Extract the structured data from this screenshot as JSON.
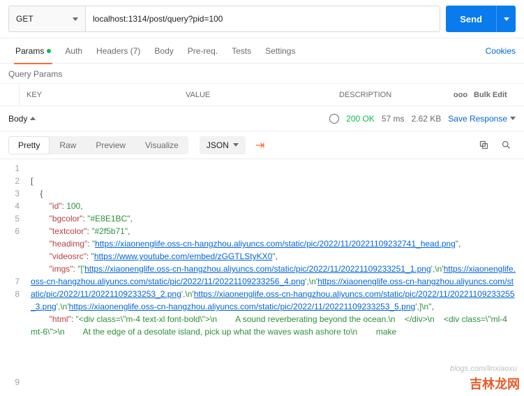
{
  "request": {
    "method": "GET",
    "url": "localhost:1314/post/query?pid=100",
    "send_label": "Send"
  },
  "tabs": {
    "params": "Params",
    "auth": "Auth",
    "headers": "Headers (7)",
    "body": "Body",
    "prereq": "Pre-req.",
    "tests": "Tests",
    "settings": "Settings",
    "cookies": "Cookies"
  },
  "query_params_label": "Query Params",
  "kv": {
    "key": "KEY",
    "value": "VALUE",
    "desc": "DESCRIPTION",
    "more": "ooo",
    "bulk": "Bulk Edit"
  },
  "response": {
    "body_label": "Body",
    "status": "200 OK",
    "time": "57 ms",
    "size": "2.62 KB",
    "save": "Save Response"
  },
  "view": {
    "pretty": "Pretty",
    "raw": "Raw",
    "preview": "Preview",
    "visualize": "Visualize",
    "format": "JSON"
  },
  "json": {
    "id_key": "\"id\"",
    "id_val": "100",
    "bg_key": "\"bgcolor\"",
    "bg_val": "\"#E8E1BC\"",
    "tc_key": "\"textcolor\"",
    "tc_val": "\"#2f5b71\"",
    "hi_key": "\"headimg\"",
    "hi_val": "https://xiaonenglife.oss-cn-hangzhou.aliyuncs.com/static/pic/2022/11/20221109232741_head.png",
    "vs_key": "\"videosrc\"",
    "vs_val": "https://www.youtube.com/embed/zGGTLStyKX0",
    "imgs_key": "\"imgs\"",
    "imgs_pre": "\"['",
    "imgs_u1": "https://xiaonenglife.oss-cn-hangzhou.aliyuncs.com/static/pic/2022/11/20221109233251_1.png",
    "imgs_s1": "',\\n'",
    "imgs_u2": "https://xiaonenglife.oss-cn-hangzhou.aliyuncs.com/static/pic/2022/11/20221109233256_4.png",
    "imgs_s2": "',\\n'",
    "imgs_u3": "https://xiaonenglife.oss-cn-hangzhou.aliyuncs.com/static/pic/2022/11/20221109233253_2.png",
    "imgs_s3": "',\\n'",
    "imgs_u4": "https://xiaonenglife.oss-cn-hangzhou.aliyuncs.com/static/pic/2022/11/20221109233255_3.png",
    "imgs_s4": "',\\n'",
    "imgs_u5": "https://xiaonenglife.oss-cn-hangzhou.aliyuncs.com/static/pic/2022/11/20221109233253_5.png",
    "imgs_post": "',]\\n\"",
    "html_key": "\"html\"",
    "html_val": "\"<div class=\\\"m-4 text-xl font-bold\\\">\\n        A sound reverberating beyond the ocean.\\n    </div>\\n    <div class=\\\"ml-4 mt-6\\\">\\n        At the edge of a desolate island, pick up what the waves wash ashore to\\n        make"
  },
  "watermark": "吉林龙网"
}
